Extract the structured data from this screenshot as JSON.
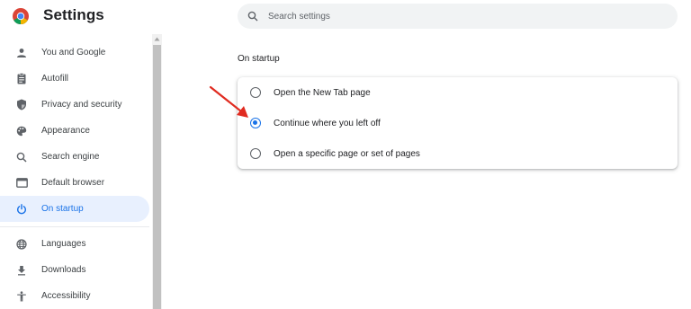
{
  "app": {
    "title": "Settings"
  },
  "search": {
    "placeholder": "Search settings",
    "value": ""
  },
  "sidebar": {
    "items": [
      {
        "label": "You and Google",
        "icon": "person-icon",
        "active": false
      },
      {
        "label": "Autofill",
        "icon": "clipboard-icon",
        "active": false
      },
      {
        "label": "Privacy and security",
        "icon": "shield-icon",
        "active": false
      },
      {
        "label": "Appearance",
        "icon": "palette-icon",
        "active": false
      },
      {
        "label": "Search engine",
        "icon": "search-icon",
        "active": false
      },
      {
        "label": "Default browser",
        "icon": "browser-icon",
        "active": false
      },
      {
        "label": "On startup",
        "icon": "power-icon",
        "active": true
      },
      {
        "label": "Languages",
        "icon": "globe-icon",
        "active": false
      },
      {
        "label": "Downloads",
        "icon": "download-icon",
        "active": false
      },
      {
        "label": "Accessibility",
        "icon": "accessibility-icon",
        "active": false
      }
    ]
  },
  "main": {
    "section_title": "On startup",
    "options": [
      {
        "label": "Open the New Tab page",
        "checked": false
      },
      {
        "label": "Continue where you left off",
        "checked": true
      },
      {
        "label": "Open a specific page or set of pages",
        "checked": false
      }
    ]
  },
  "colors": {
    "accent": "#1a73e8",
    "active_nav_bg": "#e8f0fe",
    "annotation_arrow": "#e02b20",
    "text_primary": "#202124",
    "icon_grey": "#5f6368"
  }
}
